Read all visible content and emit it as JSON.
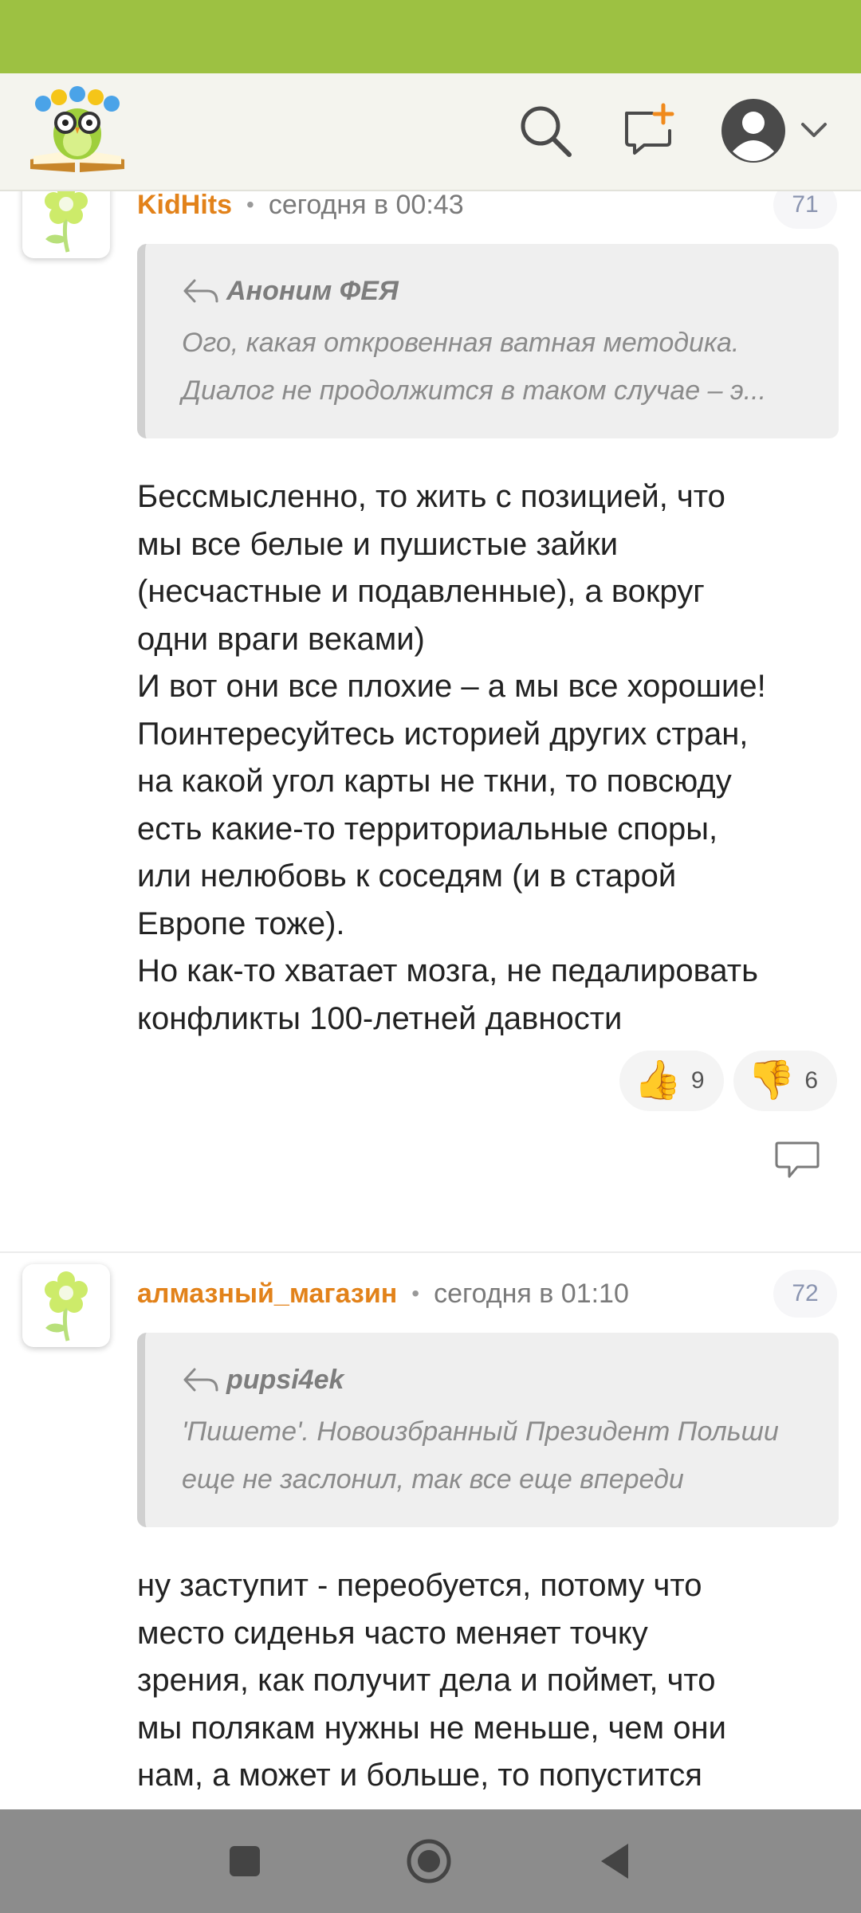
{
  "colors": {
    "status_bar": "#9dc142",
    "header_bg": "#f4f4ee",
    "author": "#e2821a",
    "badge_text": "#8a94b0",
    "nav_bar": "#8c8c8c"
  },
  "header": {
    "logo_icon": "owl-reading-book-logo",
    "search_icon": "search-icon",
    "new_message_icon": "new-message-icon",
    "profile_icon": "user-avatar-icon",
    "dropdown_icon": "chevron-down-icon"
  },
  "comments": [
    {
      "author": "KidHits",
      "separator": "•",
      "time": "сегодня в 00:43",
      "number": "71",
      "quote": {
        "author": "Аноним ФЕЯ",
        "text_line1": "Ого, какая откровенная ватная методика.",
        "text_line2": "Диалог не продолжится в таком случае – э..."
      },
      "text": "Бессмысленно, то жить с позицией, что\nмы все белые и пушистые зайки\n(несчастные и подавленные), а вокруг\nодни враги веками)\nИ вот они все плохие – а мы все хорошие!\nПоинтересуйтесь историей других стран,\nна какой угол карты не ткни, то повсюду\nесть какие-то территориальные споры,\nили нелюбовь к соседям (и в старой\nЕвропе тоже).\nНо как-то хватает мозга, не педалировать\nконфликты 100-летней давности",
      "likes": "9",
      "dislikes": "6"
    },
    {
      "author": "алмазный_магазин",
      "separator": "•",
      "time": "сегодня в 01:10",
      "number": "72",
      "quote": {
        "author": "pupsi4ek",
        "text_line1": "'Пишете'. Новоизбранный Президент Польши",
        "text_line2": "еще не заслонил, так все еще впереди"
      },
      "text": "ну заступит - переобуется, потому что\nместо сиденья часто меняет точку\nзрения, как получит дела и поймет, что\nмы полякам нужны не меньше, чем они\nнам, а может и больше, то попустится"
    }
  ],
  "nav": {
    "recents_icon": "square-recents-icon",
    "home_icon": "circle-home-icon",
    "back_icon": "triangle-back-icon"
  }
}
